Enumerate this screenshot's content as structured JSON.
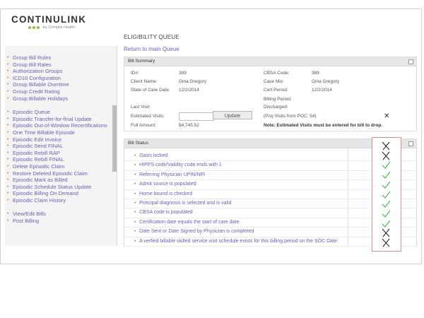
{
  "brand": {
    "name": "CONTINULINK",
    "tagline": "by Complia Health",
    "dot_color": "#8dbf3f"
  },
  "sidebar": {
    "groups": [
      {
        "items": [
          "Group Bill Rules",
          "Group Bill Rates",
          "Authorization Groups",
          "ICD10 Configuration",
          "Group Billable Overtime",
          "Group Credit Rating",
          "Group Billable Holidays"
        ]
      },
      {
        "items": [
          "Episodic Queue",
          "Episodic Transfer-for-final Update",
          "Episodic Out-of-Window Recertifications",
          "One Time Billable Episode",
          "Episodic Edit Invoice",
          "Episodic Send FINAL",
          "Episodic Rebill RAP",
          "Episodic Rebill FINAL",
          "Delete Episodic Claim",
          "Restore Deleted Episodic Claim",
          "Episodic Mark as Billed",
          "Episodic Schedule Status Update",
          "Episodic Billing On Demand",
          "Episodic Claim History"
        ]
      },
      {
        "items": [
          "View/Edit Bills",
          "Post Billing"
        ]
      }
    ]
  },
  "main": {
    "title": "ELIGIBILITY QUEUE",
    "back_link": "Return to main Queue"
  },
  "bill_summary": {
    "header": "Bill Summary",
    "id_label": "ID#:",
    "id_value": "389",
    "client_label": "Client Name:",
    "client_value": "Gina Gregory",
    "soc_label": "State of Care Date:",
    "soc_value": "12/2/2014",
    "cbsa_label": "CBSA Code:",
    "cbsa_value": "389",
    "casemix_label": "Case Mix:",
    "casemix_value": "Gina Gregory",
    "cert_label": "Cert Period:",
    "cert_value": "12/2/2014",
    "billing_period_label": "Billing Period:",
    "last_visit_label": "Last Visit:",
    "discharged_label": "Discharged:",
    "est_visits_label": "Estimated Visits:",
    "update_button": "Update",
    "proj_visits": "(Proj Visits from POC: 54)",
    "full_amount_label": "Full Amount:",
    "full_amount_value": "$4,745.52",
    "note": "Note: Estimated Visits must be entered for bill to drop."
  },
  "bill_status": {
    "header": "Bill Status",
    "items": [
      "Oasis locked",
      "HIPPS code/Validity code ends with 1",
      "Referring Physician UPIN/NPI",
      "Admit source is populated",
      "Home bound is checked",
      "Principal diagnosis is selected and is valid",
      "CBSA code is populated",
      "Certification date equals the start of care date",
      "Date Sent or Date Signed by Physician is completed",
      "A verfied billable skilled service visit schedule exists for this billing period on the SOC Date"
    ],
    "results": [
      "fail",
      "fail",
      "pass",
      "pass",
      "pass",
      "pass",
      "pass",
      "pass",
      "pass",
      "fail",
      "fail"
    ],
    "colors": {
      "pass": "#3dbb3d",
      "fail": "#222222",
      "highlight": "#e28b8b"
    }
  }
}
